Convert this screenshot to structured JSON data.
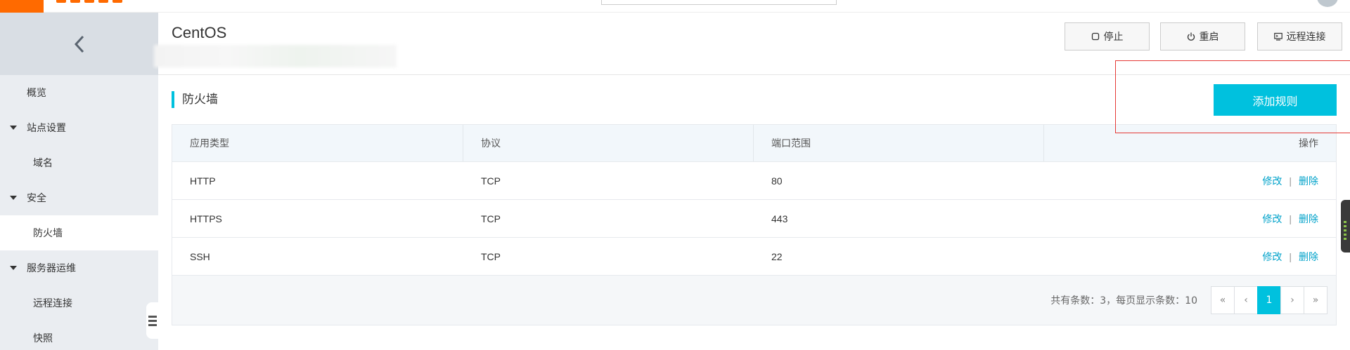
{
  "app": {
    "brand_color": "#ff6a00",
    "accent_color": "#00c1de"
  },
  "sidebar": {
    "back_icon": "chevron-left-icon",
    "items": [
      {
        "label": "概览",
        "level": "top"
      },
      {
        "label": "站点设置",
        "level": "group"
      },
      {
        "label": "域名",
        "level": "sub"
      },
      {
        "label": "安全",
        "level": "group"
      },
      {
        "label": "防火墙",
        "level": "sub",
        "active": true
      },
      {
        "label": "服务器运维",
        "level": "group"
      },
      {
        "label": "远程连接",
        "level": "sub"
      },
      {
        "label": "快照",
        "level": "sub"
      }
    ]
  },
  "header": {
    "instance_name": "CentOS",
    "actions": [
      {
        "label": "停止",
        "icon": "stop-icon"
      },
      {
        "label": "重启",
        "icon": "power-icon"
      },
      {
        "label": "远程连接",
        "icon": "remote-terminal-icon"
      }
    ]
  },
  "firewall": {
    "title": "防火墙",
    "add_button": "添加规则",
    "columns": [
      "应用类型",
      "协议",
      "端口范围",
      "操作"
    ],
    "rows": [
      {
        "app": "HTTP",
        "protocol": "TCP",
        "port": "80",
        "edit": "修改",
        "delete": "删除"
      },
      {
        "app": "HTTPS",
        "protocol": "TCP",
        "port": "443",
        "edit": "修改",
        "delete": "删除"
      },
      {
        "app": "SSH",
        "protocol": "TCP",
        "port": "22",
        "edit": "修改",
        "delete": "删除"
      }
    ],
    "separator": "|",
    "footer_text": "共有条数：3，每页显示条数：10",
    "pagination": {
      "first": "«",
      "prev": "‹",
      "current": "1",
      "next": "›",
      "last": "»"
    }
  }
}
